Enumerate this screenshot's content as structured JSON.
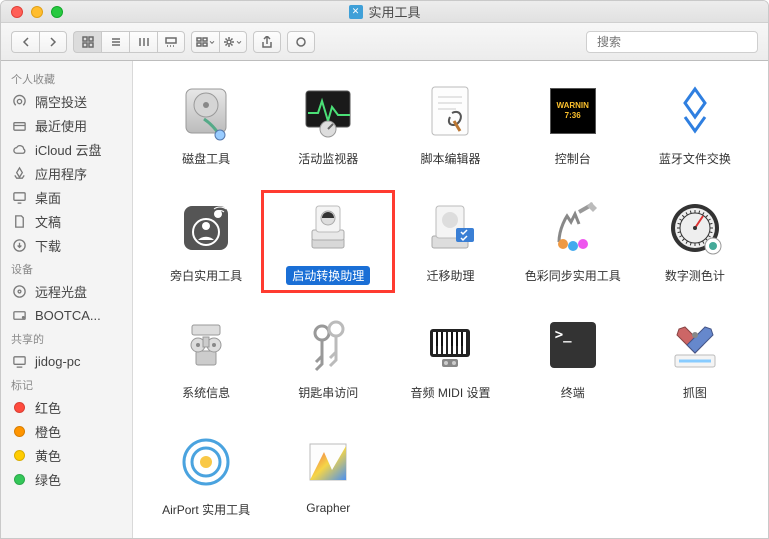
{
  "window": {
    "title": "实用工具",
    "search_placeholder": "搜索"
  },
  "sidebar": {
    "favorites_header": "个人收藏",
    "favorites": [
      {
        "label": "隔空投送"
      },
      {
        "label": "最近使用"
      },
      {
        "label": "iCloud 云盘"
      },
      {
        "label": "应用程序"
      },
      {
        "label": "桌面"
      },
      {
        "label": "文稿"
      },
      {
        "label": "下载"
      }
    ],
    "devices_header": "设备",
    "devices": [
      {
        "label": "远程光盘"
      },
      {
        "label": "BOOTCA..."
      }
    ],
    "shared_header": "共享的",
    "shared": [
      {
        "label": "jidog-pc"
      }
    ],
    "tags_header": "标记",
    "tags": [
      {
        "label": "红色",
        "color": "#ff4b3e"
      },
      {
        "label": "橙色",
        "color": "#ff9500"
      },
      {
        "label": "黄色",
        "color": "#ffcc00"
      },
      {
        "label": "绿色",
        "color": "#34c759"
      }
    ]
  },
  "items": [
    {
      "label": "磁盘工具"
    },
    {
      "label": "活动监视器"
    },
    {
      "label": "脚本编辑器"
    },
    {
      "label": "控制台",
      "warn_l1": "WARNIN",
      "warn_l2": "7:36"
    },
    {
      "label": "蓝牙文件交换"
    },
    {
      "label": "旁白实用工具"
    },
    {
      "label": "启动转换助理",
      "selected": true
    },
    {
      "label": "迁移助理"
    },
    {
      "label": "色彩同步实用工具"
    },
    {
      "label": "数字测色计"
    },
    {
      "label": "系统信息"
    },
    {
      "label": "钥匙串访问"
    },
    {
      "label": "音频 MIDI 设置"
    },
    {
      "label": "终端",
      "prompt": ">_"
    },
    {
      "label": "抓图"
    },
    {
      "label": "AirPort 实用工具"
    },
    {
      "label": "Grapher"
    }
  ],
  "highlight_index": 6
}
